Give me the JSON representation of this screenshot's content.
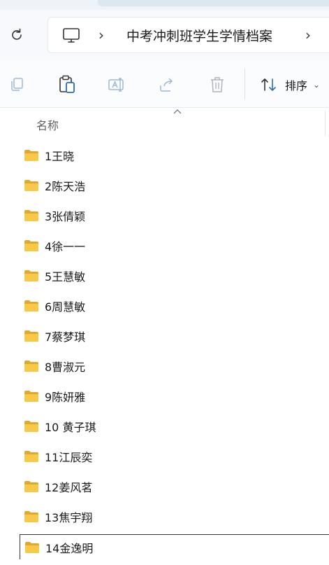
{
  "address_bar": {
    "refresh_icon": "refresh-icon",
    "pc_icon": "this-pc-icon",
    "chevron": "›",
    "current_folder": "中考冲刺班学生学情档案"
  },
  "command_bar": {
    "copy_icon": "copy-icon",
    "paste_icon": "paste-icon",
    "rename_icon": "rename-icon",
    "share_icon": "share-icon",
    "delete_icon": "delete-icon",
    "sort_label": "排序",
    "sort_icon": "sort-icon"
  },
  "list_header": {
    "name_column": "名称"
  },
  "folders": [
    "1王晓",
    "2陈天浩",
    "3张倩颖",
    "4徐一一",
    "5王慧敏",
    "6周慧敏",
    "7蔡梦琪",
    "8曹淑元",
    "9陈妍雅",
    "10 黄子琪",
    "11江辰奕",
    "12姜风茗",
    "13焦宇翔",
    "14金逸明"
  ],
  "colors": {
    "folder_yellow": "#f7c948",
    "folder_dark": "#e0a82e",
    "accent_blue": "#2b6cb0"
  }
}
